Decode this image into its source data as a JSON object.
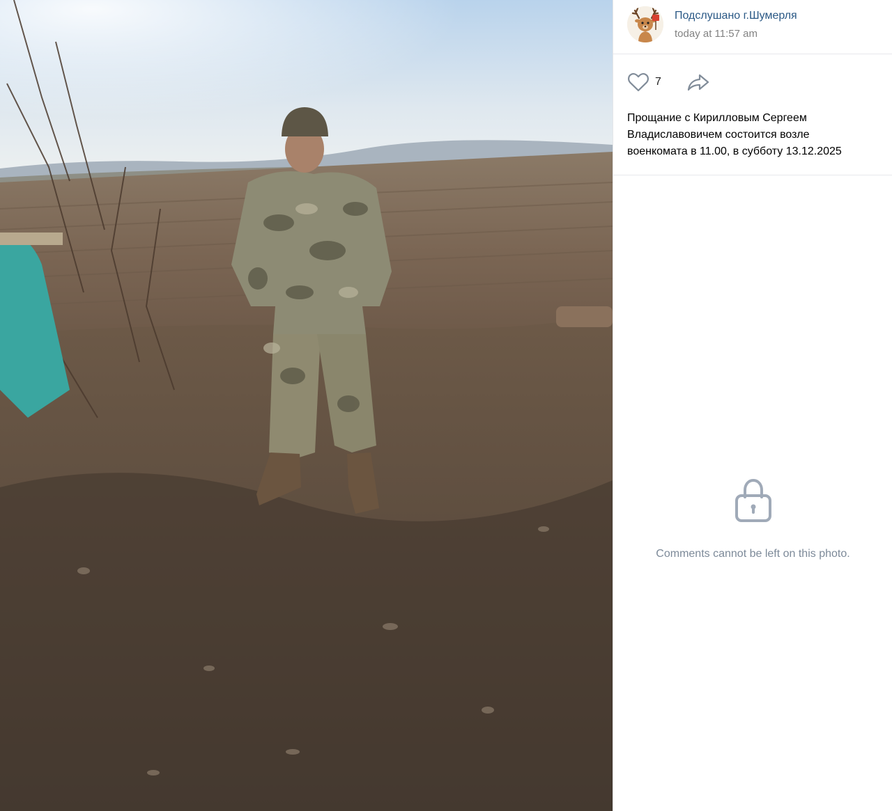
{
  "post": {
    "author": "Подслушано г.Шумерля",
    "timestamp": "today at 11:57 am",
    "likes": "7",
    "caption_lines": [
      "Прощание с Кирилловым Сергеем",
      "Владиславовичем состоится возле",
      "военкомата в 11.00, в субботу 13.12.2025"
    ]
  },
  "comments": {
    "locked_message": "Comments cannot be left on this photo."
  },
  "icons": {
    "like": "heart-outline",
    "share": "share-arrow",
    "lock": "padlock",
    "avatar": "deer-mascot"
  },
  "colors": {
    "link": "#2a5885",
    "muted": "#828282",
    "lock": "#a0aab8"
  }
}
